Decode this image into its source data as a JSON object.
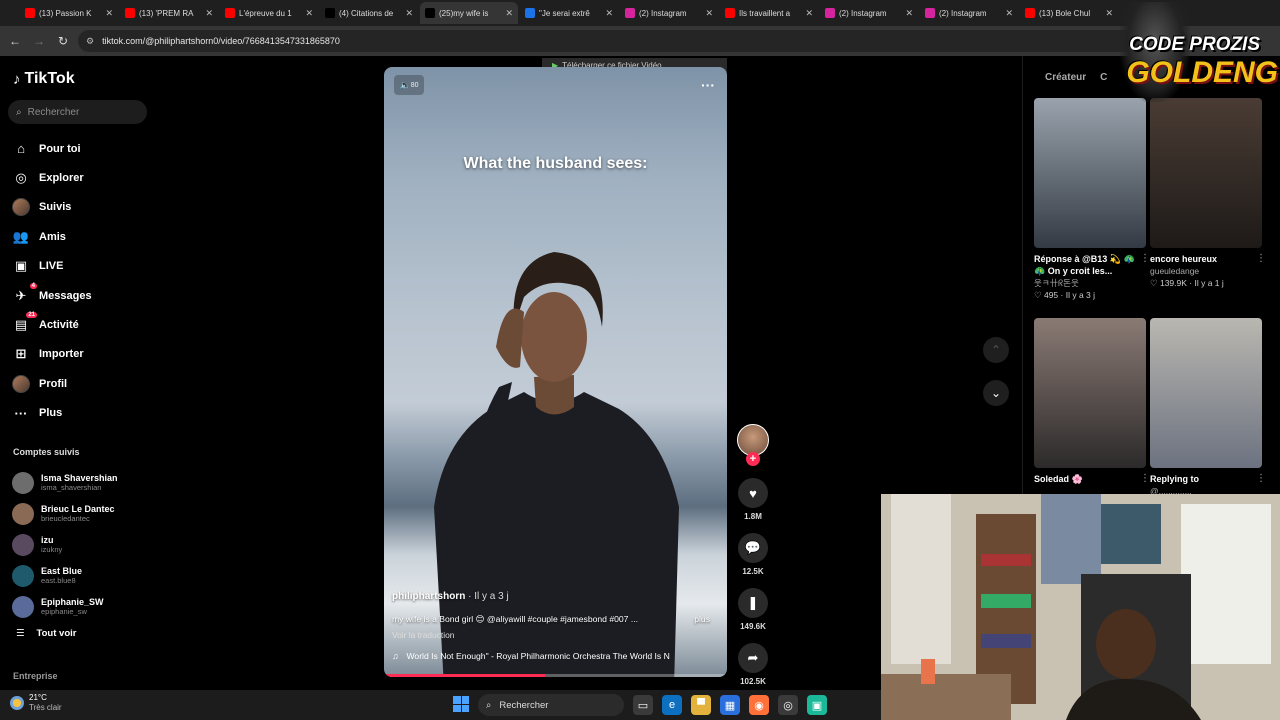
{
  "browser": {
    "tabs": [
      {
        "title": "(13) Passion K",
        "icon": "youtube-icon",
        "color": "#ff0000",
        "active": false
      },
      {
        "title": "(13) 'PREM RA",
        "icon": "youtube-icon",
        "color": "#ff0000",
        "active": false
      },
      {
        "title": "L'épreuve du 1",
        "icon": "youtube-icon",
        "color": "#ff0000",
        "active": false
      },
      {
        "title": "(4) Citations de",
        "icon": "x-icon",
        "color": "#000000",
        "active": false
      },
      {
        "title": "(25)my wife is",
        "icon": "tiktok-icon",
        "color": "#000000",
        "active": true
      },
      {
        "title": "\"Je serai extrê",
        "icon": "generic-icon",
        "color": "#1a73e8",
        "active": false
      },
      {
        "title": "(2) Instagram",
        "icon": "instagram-icon",
        "color": "#d6249f",
        "active": false
      },
      {
        "title": "Ils travaillent a",
        "icon": "youtube-icon",
        "color": "#ff0000",
        "active": false
      },
      {
        "title": "(2) Instagram",
        "icon": "instagram-icon",
        "color": "#d6249f",
        "active": false
      },
      {
        "title": "(2) Instagram",
        "icon": "instagram-icon",
        "color": "#d6249f",
        "active": false
      },
      {
        "title": "(13) Bole Chul",
        "icon": "youtube-icon",
        "color": "#ff0000",
        "active": false
      }
    ],
    "url": "tiktok.com/@philiphartshorn0/video/7668413547331865870"
  },
  "sidebar": {
    "logo": "TikTok",
    "search_placeholder": "Rechercher",
    "nav": [
      {
        "label": "Pour toi",
        "icon": "home-icon",
        "glyph": "⌂"
      },
      {
        "label": "Explorer",
        "icon": "compass-icon",
        "glyph": "◎"
      },
      {
        "label": "Suivis",
        "icon": "avatar-icon",
        "glyph": ""
      },
      {
        "label": "Amis",
        "icon": "friends-icon",
        "glyph": "👥"
      },
      {
        "label": "LIVE",
        "icon": "live-icon",
        "glyph": "▣"
      },
      {
        "label": "Messages",
        "icon": "messages-icon",
        "glyph": "✈",
        "badge": "4"
      },
      {
        "label": "Activité",
        "icon": "activity-icon",
        "glyph": "▤",
        "badge": "21"
      },
      {
        "label": "Importer",
        "icon": "upload-icon",
        "glyph": "⊞"
      },
      {
        "label": "Profil",
        "icon": "profile-avatar-icon",
        "glyph": ""
      },
      {
        "label": "Plus",
        "icon": "more-icon",
        "glyph": "···"
      }
    ],
    "following_title": "Comptes suivis",
    "following": [
      {
        "name": "Isma Shavershian",
        "handle": "isma_shavershian",
        "color": "#6d6d6d"
      },
      {
        "name": "Brieuc Le Dantec",
        "handle": "brieucledantec",
        "color": "#8a6a55"
      },
      {
        "name": "izu",
        "handle": "izukny",
        "color": "#5a4a60"
      },
      {
        "name": "East Blue",
        "handle": "east.blue8",
        "color": "#1e5a6b"
      },
      {
        "name": "Epiphanie_SW",
        "handle": "epiphanie_sw",
        "color": "#5a6a9a"
      }
    ],
    "see_all": "Tout voir",
    "company": "Entreprise"
  },
  "video": {
    "overlay_caption": "What the husband sees:",
    "download_bar": "Télécharger ce fichier Vidéo",
    "volume_label": "80",
    "author": "philiphartshorn",
    "ago": "· Il y a 3 j",
    "description": "my wife is a Bond girl 😊 @aliyawill #couple #jamesbond #007 ...",
    "more": "plus",
    "translate": "Voir la traduction",
    "music": "World Is Not Enough\" - Royal Philharmonic Orchestra  The World Is N",
    "progress": 0.47
  },
  "actions": {
    "likes": "1.8M",
    "comments": "12.5K",
    "saves": "149.6K",
    "shares": "102.5K"
  },
  "right_panel": {
    "tabs": [
      "Créateur",
      "C"
    ],
    "videos": [
      {
        "caption": "Réponse à @B13 💫 🦚 🦚 On y croit les...",
        "sub": "웃ㅋ卄ᖇ돈웃",
        "likes": "♡ 495 · Il y a 3 j",
        "colors": [
          "#9aa3ad",
          "#333a44"
        ]
      },
      {
        "caption": "encore heureux",
        "sub": "gueuledange",
        "likes": "♡ 139.9K · Il y a 1 j",
        "colors": [
          "#4a3c34",
          "#1e1a18"
        ]
      },
      {
        "caption": "Soledad 🌸",
        "sub": "",
        "likes": "",
        "colors": [
          "#8a7a74",
          "#2c2a2a"
        ]
      },
      {
        "caption": "Replying to",
        "sub": "@..............",
        "likes": "",
        "colors": [
          "#b9b7b0",
          "#6c7280"
        ]
      }
    ]
  },
  "brand": {
    "line1": "CODE PROZIS",
    "line2": "GOLDENG"
  },
  "taskbar": {
    "temp": "21°C",
    "weather": "Très clair",
    "search": "Rechercher"
  }
}
